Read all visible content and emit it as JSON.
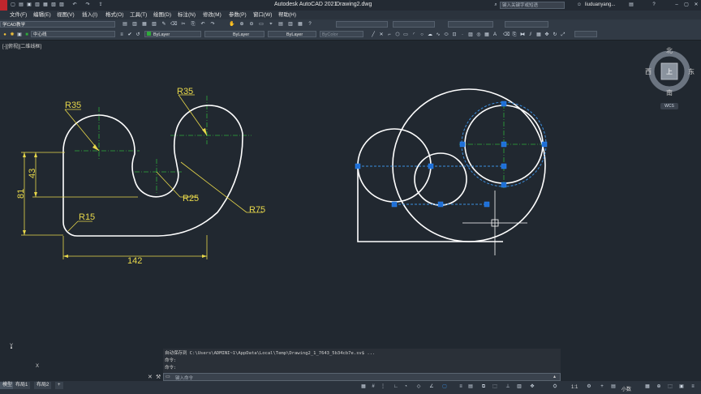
{
  "titlebar": {
    "app_title": "Autodesk AutoCAD 2021",
    "file_name": "Drawing2.dwg",
    "search_placeholder": "键入关键字或短语",
    "username": "liuduanyang..."
  },
  "menus": [
    "文件(F)",
    "编辑(E)",
    "视图(V)",
    "插入(I)",
    "格式(O)",
    "工具(T)",
    "绘图(D)",
    "标注(N)",
    "修改(M)",
    "参数(P)",
    "窗口(W)",
    "帮助(H)"
  ],
  "toolbar": {
    "workspace": "学CAD教学",
    "layer": "中心线",
    "color": "ByLayer",
    "linetype": "ByLayer",
    "lineweight": "ByLayer",
    "plotstyle": "ByColor"
  },
  "viewport": {
    "label": "[-][俯视][二维线框]",
    "compass": {
      "north": "北",
      "south": "南",
      "east": "东",
      "west": "西",
      "top": "上"
    },
    "wcs": "WCS"
  },
  "dimensions": {
    "r35_left": "R35",
    "r35_right": "R35",
    "r25": "R25",
    "r75": "R75",
    "r15": "R15",
    "h43": "43",
    "h81": "81",
    "w142": "142"
  },
  "command": {
    "line1": "自动保存到 C:\\Users\\ADMINI~1\\AppData\\Local\\Temp\\Drawing2_1_7643_5b34cb7e.sv$ ...",
    "line2": "命令:",
    "line3": "命令:",
    "input_placeholder": "键入命令"
  },
  "status": {
    "tab_model": "模型",
    "tab_layout1": "布局1",
    "tab_layout2": "布局2",
    "scale": "1:1",
    "units": "小数"
  },
  "colors": {
    "background": "#212830",
    "geometry": "#ffffff",
    "dimension": "#e8d84a",
    "centerline": "#2faa3a",
    "grip": "#1f6fd6",
    "selection": "#3b8fe0"
  }
}
